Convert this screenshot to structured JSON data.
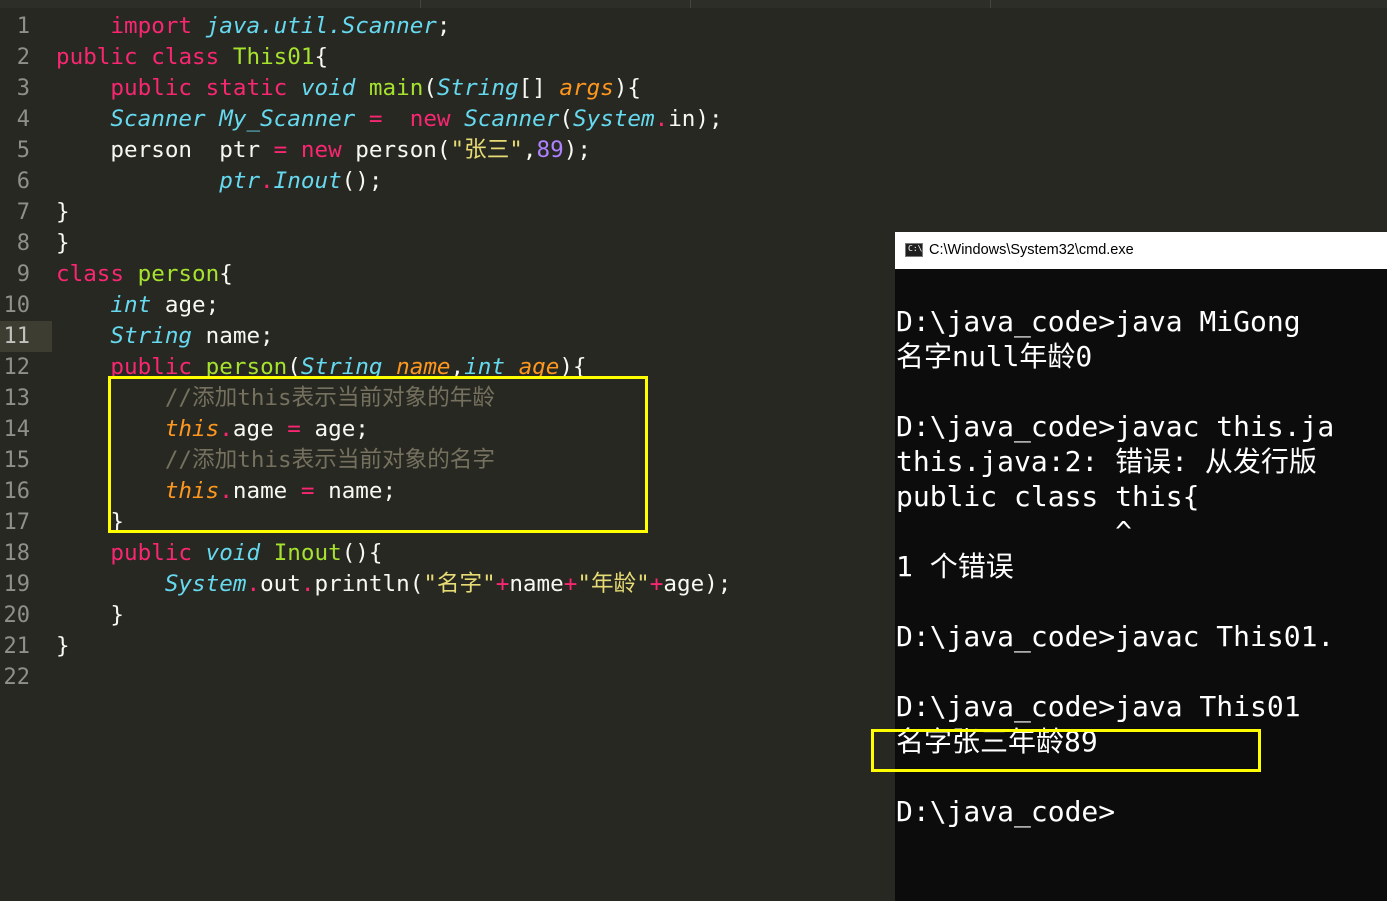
{
  "editor": {
    "line_numbers": [
      "1",
      "2",
      "3",
      "4",
      "5",
      "6",
      "7",
      "8",
      "9",
      "10",
      "11",
      "12",
      "13",
      "14",
      "15",
      "16",
      "17",
      "18",
      "19",
      "20",
      "21",
      "22"
    ],
    "active_line": 11
  },
  "code": {
    "l1": {
      "indent": "    ",
      "kw1": "import",
      "sp": " ",
      "pkg": "java.util.Scanner",
      "end": ";"
    },
    "l2": {
      "kw1": "public",
      "sp1": " ",
      "kw2": "class",
      "sp2": " ",
      "cls": "This01",
      "end": "{"
    },
    "l3": {
      "indent": "    ",
      "kw1": "public",
      "sp1": " ",
      "kw2": "static",
      "sp2": " ",
      "ty1": "void",
      "sp3": " ",
      "fn": "main",
      "p1": "(",
      "ty2": "String",
      "br": "[] ",
      "arg": "args",
      "end": "){"
    },
    "l4": {
      "indent": "    ",
      "ty1": "Scanner",
      "sp1": " ",
      "var": "My_Scanner",
      "sp2": " ",
      "op": "=",
      "sp3": "  ",
      "kw": "new",
      "sp4": " ",
      "ty2": "Scanner",
      "p1": "(",
      "ty3": "System",
      "dot": ".",
      "fld": "in",
      "end": ");"
    },
    "l5": {
      "indent": "    ",
      "t1": "person  ptr ",
      "op": "=",
      "sp": " ",
      "kw": "new",
      "t2": " person(",
      "str": "\"张三\"",
      "comma": ",",
      "num": "89",
      "end": ");"
    },
    "l6": {
      "indent": "            ",
      "v": "ptr",
      "dot": ".",
      "m": "Inout",
      "end": "();"
    },
    "l7": {
      "t": "}"
    },
    "l8": {
      "t": "}"
    },
    "l9": {
      "kw": "class",
      "sp": " ",
      "cls": "person",
      "end": "{"
    },
    "l10": {
      "indent": "    ",
      "ty": "int",
      "rest": " age;"
    },
    "l11": {
      "indent": "    ",
      "ty": "String",
      "rest": " name;"
    },
    "l12": {
      "indent": "    ",
      "kw": "public",
      "sp": " ",
      "fn": "person",
      "p1": "(",
      "ty1": "String",
      "sp2": " ",
      "a1": "name",
      "comma": ",",
      "ty2": "int",
      "sp3": " ",
      "a2": "age",
      "end": "){"
    },
    "l13": {
      "indent": "        ",
      "cm": "//添加this表示当前对象的年龄"
    },
    "l14": {
      "indent": "        ",
      "th": "this",
      "dot": ".",
      "f": "age ",
      "op": "=",
      "rest": " age;"
    },
    "l15": {
      "indent": "        ",
      "cm": "//添加this表示当前对象的名字"
    },
    "l16": {
      "indent": "        ",
      "th": "this",
      "dot": ".",
      "f": "name ",
      "op": "=",
      "rest": " name;"
    },
    "l17": {
      "indent": "    ",
      "t": "}"
    },
    "l18": {
      "indent": "    ",
      "kw": "public",
      "sp1": " ",
      "ty": "void",
      "sp2": " ",
      "fn": "Inout",
      "end": "(){"
    },
    "l19": {
      "indent": "        ",
      "ty": "System",
      "dot1": ".",
      "f": "out",
      "dot2": ".",
      "m": "println(",
      "s1": "\"名字\"",
      "op1": "+",
      "v1": "name",
      "op2": "+",
      "s2": "\"年龄\"",
      "op3": "+",
      "v2": "age",
      "end": ");"
    },
    "l20": {
      "indent": "    ",
      "t": "}"
    },
    "l21": {
      "t": "}"
    },
    "l22": {
      "t": ""
    }
  },
  "cmd": {
    "title": "C:\\Windows\\System32\\cmd.exe",
    "icon": "cmd-window-icon",
    "icon_text": "C:\\",
    "lines": [
      "D:\\java_code>java MiGong",
      "名字null年龄0",
      "",
      "D:\\java_code>javac this.ja",
      "this.java:2: 错误: 从发行版",
      "public class this{",
      "             ^",
      "1 个错误",
      "",
      "D:\\java_code>javac This01.",
      "",
      "D:\\java_code>java This01",
      "名字张三年龄89",
      "",
      "D:\\java_code>"
    ]
  },
  "colors": {
    "editor_bg": "#272822",
    "highlight_box": "#ffff00",
    "keyword": "#f92672",
    "type": "#66d9ef",
    "string": "#e6db74",
    "number": "#ae81ff",
    "comment": "#75715e",
    "cmd_bg": "#0c0c0c"
  }
}
